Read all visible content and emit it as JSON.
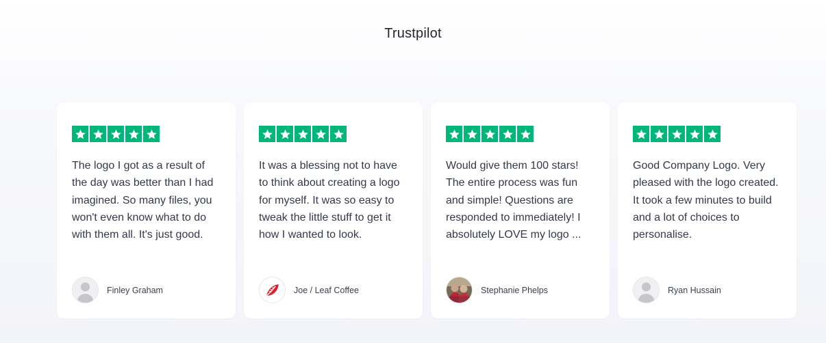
{
  "section": {
    "title": "Trustpilot"
  },
  "colors": {
    "star_green": "#00b67a",
    "card_bg": "#ffffff"
  },
  "reviews": [
    {
      "rating": 5,
      "text": "The logo I got as a result of the day was better than I had imagined. So many files, you won't even know what to do with them all. It's just good.",
      "name": "Finley Graham",
      "avatar": "default-avatar-icon"
    },
    {
      "rating": 5,
      "text": "It was a blessing not to have to think about creating a logo for myself. It was so easy to tweak the little stuff to get it how I wanted to look.",
      "name": "Joe / Leaf Coffee",
      "avatar": "leaf-logo-icon"
    },
    {
      "rating": 5,
      "text": "Would give them 100 stars! The entire process was fun and simple! Questions are responded to immediately! I absolutely LOVE my logo ...",
      "name": "Stephanie Phelps",
      "avatar": "photo-avatar"
    },
    {
      "rating": 5,
      "text": "Good Company Logo. Very pleased with the logo created. It took a few minutes to build and a lot of choices to personalise.",
      "name": "Ryan Hussain",
      "avatar": "default-avatar-icon"
    }
  ]
}
